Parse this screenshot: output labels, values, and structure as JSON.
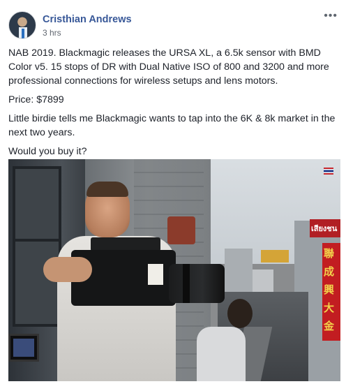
{
  "post": {
    "author": "Cristhian Andrews",
    "time": "3 hrs",
    "more_label": "•••",
    "paragraphs": [
      "NAB 2019. Blackmagic releases the URSA XL, a 6.5k sensor with BMD Color v5. 15 stops of DR with Dual Native ISO of 800 and 3200 and more professional connections for wireless setups and lens motors.",
      "Price: $7899",
      "Little birdie tells me Blackmagic wants to tap into the 6K & 8k market in the next two years.",
      "Would you buy it?"
    ]
  },
  "photo": {
    "sign_thai": "เสียงชน",
    "sign_chars": [
      "聯",
      "成",
      "興",
      "大",
      "金"
    ]
  },
  "icons": {
    "avatar": "profile-photo",
    "more": "ellipsis-icon"
  }
}
